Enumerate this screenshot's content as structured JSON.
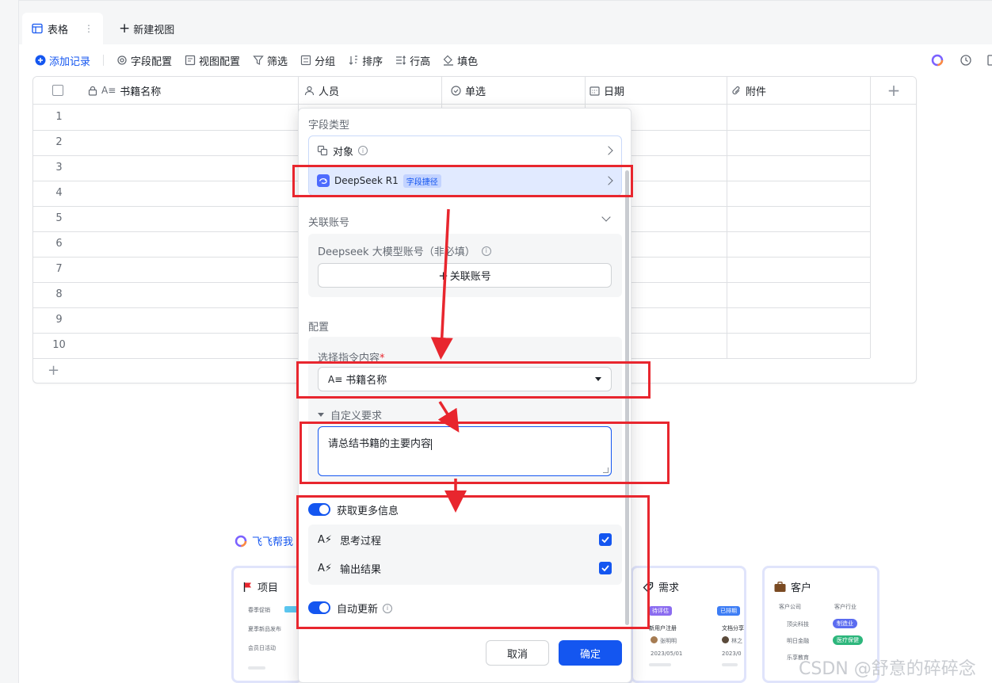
{
  "tabs": {
    "active": "表格",
    "new_view": "新建视图"
  },
  "toolbar": {
    "add_record": "添加记录",
    "field_config": "字段配置",
    "view_config": "视图配置",
    "filter": "筛选",
    "group": "分组",
    "sort": "排序",
    "row_height": "行高",
    "fill_color": "填色"
  },
  "table": {
    "columns": [
      "书籍名称",
      "人员",
      "单选",
      "日期",
      "附件"
    ],
    "rows": [
      "1",
      "2",
      "3",
      "4",
      "5",
      "6",
      "7",
      "8",
      "9",
      "10"
    ]
  },
  "panel": {
    "field_type_label": "字段类型",
    "option_object": "对象",
    "option_deepseek": "DeepSeek R1",
    "deepseek_tag": "字段捷径",
    "linked_account_label": "关联账号",
    "account_desc": "Deepseek 大模型账号（非必填）",
    "link_account_button": "关联账号",
    "config_label": "配置",
    "choose_instruction_label": "选择指令内容",
    "required_mark": "*",
    "instruction_value": "书籍名称",
    "custom_requirement_label": "自定义要求",
    "custom_requirement_value": "请总结书籍的主要内容",
    "more_info_label": "获取更多信息",
    "thinking_label": "思考过程",
    "output_label": "输出结果",
    "auto_update_label": "自动更新",
    "cancel": "取消",
    "confirm": "确定"
  },
  "templates": {
    "section_title": "飞飞帮我",
    "cards": [
      "项目",
      "需求",
      "客户"
    ],
    "project_lines": [
      "春季促销",
      "夏季新品发布",
      "会员日活动"
    ],
    "req_col1": "新用户注册",
    "req_col2": "文档分享",
    "req_badge1": "待评估",
    "req_badge2": "已排期",
    "req_person": "张明明",
    "req_person2": "林之",
    "req_date": "2023/05/01",
    "req_date2": "2023/0",
    "cust_header1": "客户公司",
    "cust_header2": "客户行业",
    "cust_rows": [
      "顶尖科技",
      "明日金融",
      "乐享教育"
    ],
    "cust_tags": [
      "制造业",
      "医疗保健"
    ]
  },
  "watermark": "CSDN @舒意的碎碎念",
  "colors": {
    "accent": "#1456f0",
    "annotation_red": "#e8262e"
  }
}
